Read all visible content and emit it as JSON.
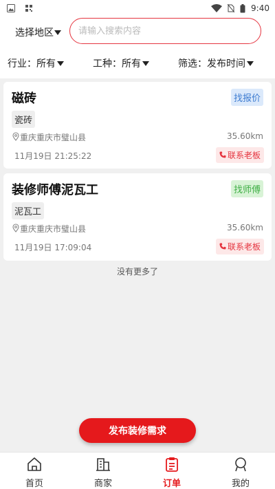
{
  "status_bar": {
    "time": "9:40"
  },
  "header": {
    "region_label": "选择地区",
    "search_placeholder": "请输入搜索内容"
  },
  "filters": [
    {
      "label": "行业：所有"
    },
    {
      "label": "工种：所有"
    },
    {
      "label": "筛选：发布时间"
    }
  ],
  "cards": [
    {
      "title": "磁砖",
      "badge": "找报价",
      "tag": "瓷砖",
      "location": "重庆重庆市璧山县",
      "distance": "35.60km",
      "time": "11月19日 21:25:22",
      "contact": "联系老板"
    },
    {
      "title": "装修师傅泥瓦工",
      "badge": "找师傅",
      "tag": "泥瓦工",
      "location": "重庆重庆市璧山县",
      "distance": "35.60km",
      "time": "11月19日 17:09:04",
      "contact": "联系老板"
    }
  ],
  "no_more": "没有更多了",
  "publish_button": "发布装修需求",
  "tabs": [
    {
      "label": "首页",
      "icon": "home-icon"
    },
    {
      "label": "商家",
      "icon": "building-icon"
    },
    {
      "label": "订单",
      "icon": "order-icon",
      "active": true
    },
    {
      "label": "我的",
      "icon": "user-icon"
    }
  ],
  "colors": {
    "accent": "#e5191c",
    "search_border": "#e5343f",
    "blue_badge": "#3d7bd0",
    "green_badge": "#3fae45"
  }
}
